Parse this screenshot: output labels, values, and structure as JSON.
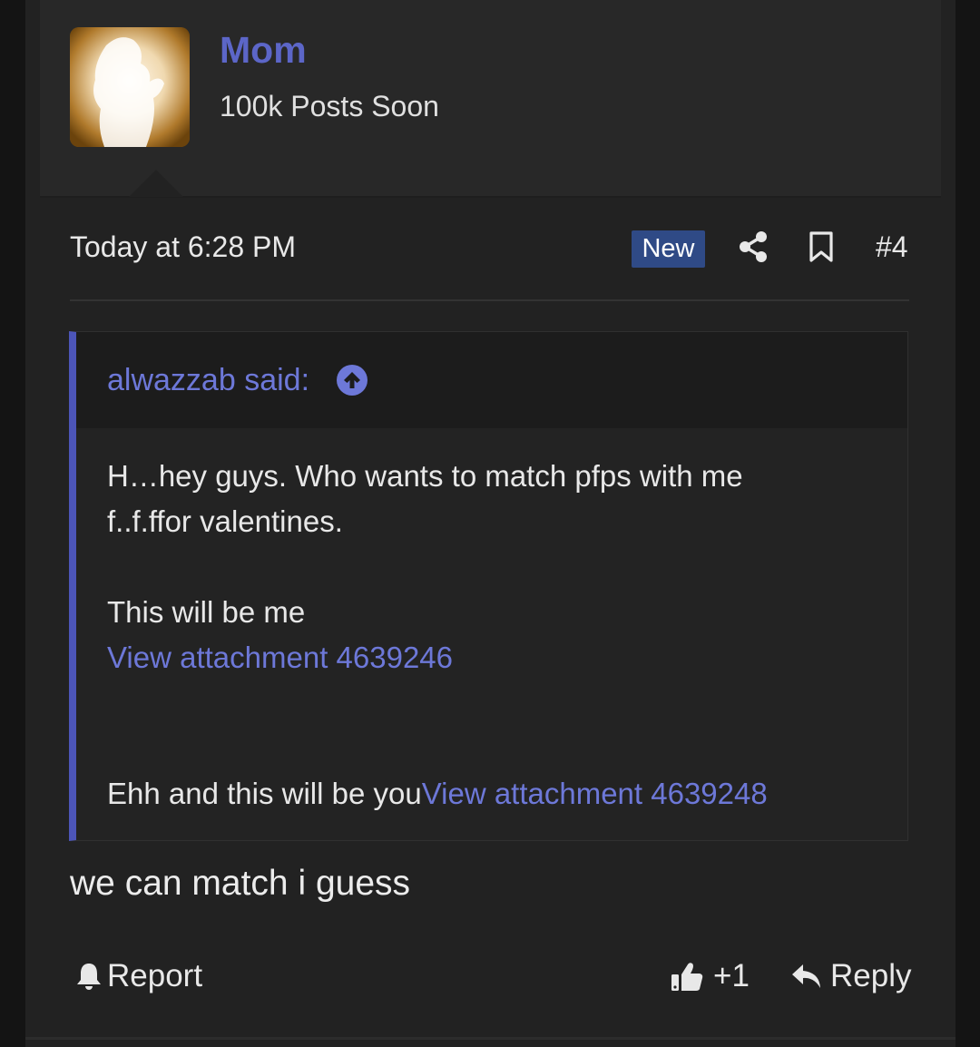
{
  "user": {
    "name": "Mom",
    "title": "100k Posts Soon",
    "name_color": "#5c66c8"
  },
  "post": {
    "date": "Today at 6:28 PM",
    "badge": "New",
    "number": "#4",
    "message": "we can match i guess"
  },
  "quote": {
    "author": "alwazzab said:",
    "line1": "H…hey guys. Who wants to match pfps with me",
    "line2": "f..f.ffor valentines.",
    "line3": "This will be me",
    "link1": "View attachment 4639246",
    "line4_text": "Ehh and this will be you",
    "link2": "View attachment 4639248",
    "accent_color": "#4c55b8",
    "link_color": "#6d78d8"
  },
  "actions": {
    "report": "Report",
    "like_count": "+1",
    "reply": "Reply"
  },
  "icons": {
    "share": "share-icon",
    "bookmark": "bookmark-icon",
    "quote_jump": "arrow-up-circle-icon",
    "report": "bell-icon",
    "like": "thumbs-up-icon",
    "reply": "reply-arrow-icon"
  }
}
